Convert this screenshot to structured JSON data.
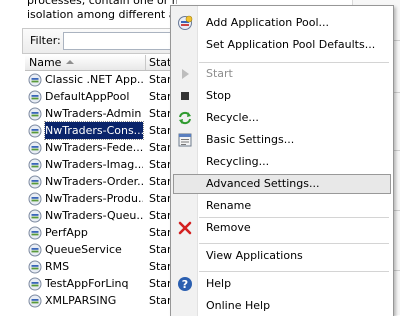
{
  "description": {
    "lines": [
      "processes, contain one or more applications, and provide",
      "isolation among different applications."
    ]
  },
  "filter": {
    "label": "Filter:",
    "value": ""
  },
  "grid": {
    "columns": {
      "name": "Name",
      "status": "Stat"
    },
    "rows": [
      {
        "name": "Classic .NET App...",
        "status": "Star"
      },
      {
        "name": "DefaultAppPool",
        "status": "Star"
      },
      {
        "name": "NwTraders-Admin",
        "status": "Star"
      },
      {
        "name": "NwTraders-Cons...",
        "status": "Star"
      },
      {
        "name": "NwTraders-Fede...",
        "status": "Star"
      },
      {
        "name": "NwTraders-Imag...",
        "status": "Star"
      },
      {
        "name": "NwTraders-Order...",
        "status": "Star"
      },
      {
        "name": "NwTraders-Produ...",
        "status": "Star"
      },
      {
        "name": "NwTraders-Queu...",
        "status": "Star"
      },
      {
        "name": "PerfApp",
        "status": "Star"
      },
      {
        "name": "QueueService",
        "status": "Star"
      },
      {
        "name": "RMS",
        "status": "Star"
      },
      {
        "name": "TestAppForLinq",
        "status": "Star"
      },
      {
        "name": "XMLPARSING",
        "status": "Star"
      }
    ],
    "selected_row": "NwTraders-Cons..."
  },
  "context_menu": {
    "items": [
      {
        "label": "Add Application Pool...",
        "icon": "add-pool-icon"
      },
      {
        "label": "Set Application Pool Defaults..."
      },
      {
        "label": "Start",
        "icon": "play-icon",
        "disabled": true
      },
      {
        "label": "Stop",
        "icon": "stop-icon"
      },
      {
        "label": "Recycle...",
        "icon": "recycle-icon"
      },
      {
        "label": "Basic Settings...",
        "icon": "settings-icon"
      },
      {
        "label": "Recycling..."
      },
      {
        "label": "Advanced Settings...",
        "highlighted": true
      },
      {
        "label": "Rename"
      },
      {
        "label": "Remove",
        "icon": "remove-x-icon"
      },
      {
        "label": "View Applications"
      },
      {
        "label": "Help",
        "icon": "help-icon"
      },
      {
        "label": "Online Help"
      }
    ]
  },
  "colors": {
    "selection": "#0a246a",
    "menu_highlight": "#e8e8e8",
    "remove_red": "#d42020",
    "recycle_green": "#2f9a2f",
    "help_blue": "#2b5fb0"
  }
}
